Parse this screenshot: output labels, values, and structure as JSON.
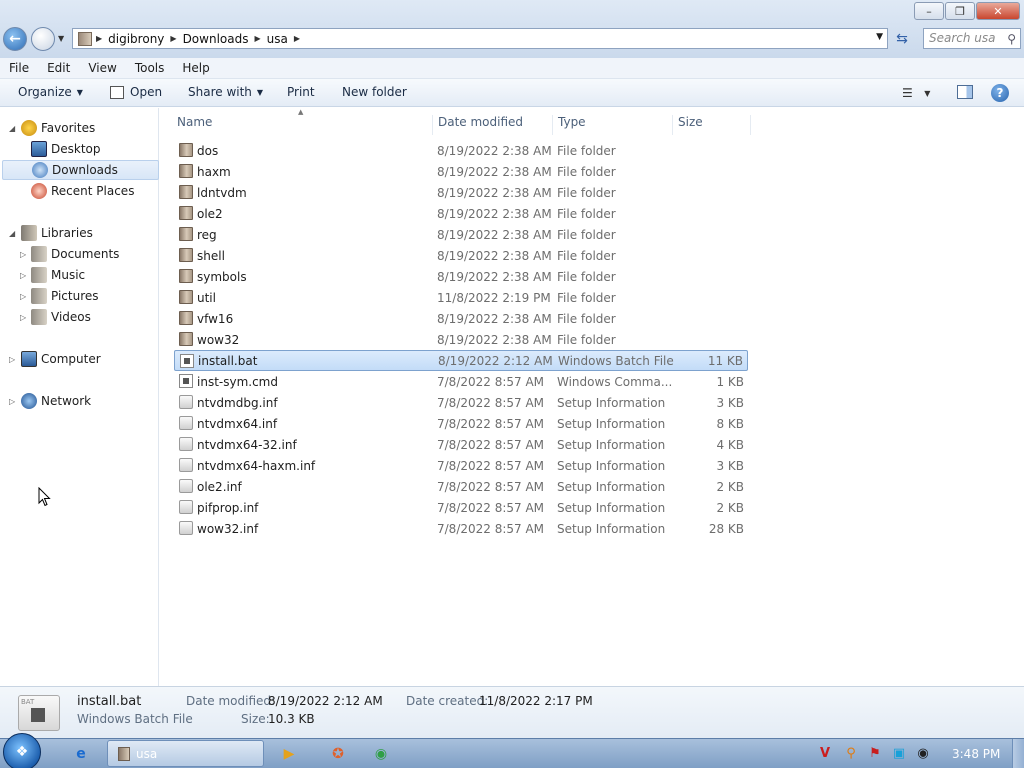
{
  "window": {
    "address": {
      "crumbs": [
        "digibrony",
        "Downloads",
        "usa"
      ]
    },
    "search_placeholder": "Search usa"
  },
  "menu": [
    "File",
    "Edit",
    "View",
    "Tools",
    "Help"
  ],
  "toolbar": {
    "organize": "Organize",
    "open": "Open",
    "share_with": "Share with",
    "print": "Print",
    "new_folder": "New folder"
  },
  "nav": {
    "favorites": "Favorites",
    "desktop": "Desktop",
    "downloads": "Downloads",
    "recent_places": "Recent Places",
    "libraries": "Libraries",
    "documents": "Documents",
    "music": "Music",
    "pictures": "Pictures",
    "videos": "Videos",
    "computer": "Computer",
    "network": "Network"
  },
  "columns": {
    "name": "Name",
    "date_modified": "Date modified",
    "type": "Type",
    "size": "Size"
  },
  "files": [
    {
      "name": "dos",
      "date": "8/19/2022 2:38 AM",
      "type": "File folder",
      "size": "",
      "kind": "folder"
    },
    {
      "name": "haxm",
      "date": "8/19/2022 2:38 AM",
      "type": "File folder",
      "size": "",
      "kind": "folder"
    },
    {
      "name": "ldntvdm",
      "date": "8/19/2022 2:38 AM",
      "type": "File folder",
      "size": "",
      "kind": "folder"
    },
    {
      "name": "ole2",
      "date": "8/19/2022 2:38 AM",
      "type": "File folder",
      "size": "",
      "kind": "folder"
    },
    {
      "name": "reg",
      "date": "8/19/2022 2:38 AM",
      "type": "File folder",
      "size": "",
      "kind": "folder"
    },
    {
      "name": "shell",
      "date": "8/19/2022 2:38 AM",
      "type": "File folder",
      "size": "",
      "kind": "folder"
    },
    {
      "name": "symbols",
      "date": "8/19/2022 2:38 AM",
      "type": "File folder",
      "size": "",
      "kind": "folder"
    },
    {
      "name": "util",
      "date": "11/8/2022 2:19 PM",
      "type": "File folder",
      "size": "",
      "kind": "folder"
    },
    {
      "name": "vfw16",
      "date": "8/19/2022 2:38 AM",
      "type": "File folder",
      "size": "",
      "kind": "folder"
    },
    {
      "name": "wow32",
      "date": "8/19/2022 2:38 AM",
      "type": "File folder",
      "size": "",
      "kind": "folder"
    },
    {
      "name": "install.bat",
      "date": "8/19/2022 2:12 AM",
      "type": "Windows Batch File",
      "size": "11 KB",
      "kind": "batch",
      "selected": true
    },
    {
      "name": "inst-sym.cmd",
      "date": "7/8/2022 8:57 AM",
      "type": "Windows Comma...",
      "size": "1 KB",
      "kind": "batch"
    },
    {
      "name": "ntvdmdbg.inf",
      "date": "7/8/2022 8:57 AM",
      "type": "Setup Information",
      "size": "3 KB",
      "kind": "inf"
    },
    {
      "name": "ntvdmx64.inf",
      "date": "7/8/2022 8:57 AM",
      "type": "Setup Information",
      "size": "8 KB",
      "kind": "inf"
    },
    {
      "name": "ntvdmx64-32.inf",
      "date": "7/8/2022 8:57 AM",
      "type": "Setup Information",
      "size": "4 KB",
      "kind": "inf"
    },
    {
      "name": "ntvdmx64-haxm.inf",
      "date": "7/8/2022 8:57 AM",
      "type": "Setup Information",
      "size": "3 KB",
      "kind": "inf"
    },
    {
      "name": "ole2.inf",
      "date": "7/8/2022 8:57 AM",
      "type": "Setup Information",
      "size": "2 KB",
      "kind": "inf"
    },
    {
      "name": "pifprop.inf",
      "date": "7/8/2022 8:57 AM",
      "type": "Setup Information",
      "size": "2 KB",
      "kind": "inf"
    },
    {
      "name": "wow32.inf",
      "date": "7/8/2022 8:57 AM",
      "type": "Setup Information",
      "size": "28 KB",
      "kind": "inf"
    }
  ],
  "details": {
    "icon_text": "BAT",
    "name": "install.bat",
    "type": "Windows Batch File",
    "date_modified_label": "Date modified:",
    "date_modified": "8/19/2022 2:12 AM",
    "size_label": "Size:",
    "size": "10.3 KB",
    "date_created_label": "Date created:",
    "date_created": "11/8/2022 2:17 PM"
  },
  "taskbar": {
    "explorer_label": "usa",
    "clock": "3:48 PM"
  },
  "colors": {
    "selection": "#c3dcf8",
    "accent": "#2f6db5"
  }
}
